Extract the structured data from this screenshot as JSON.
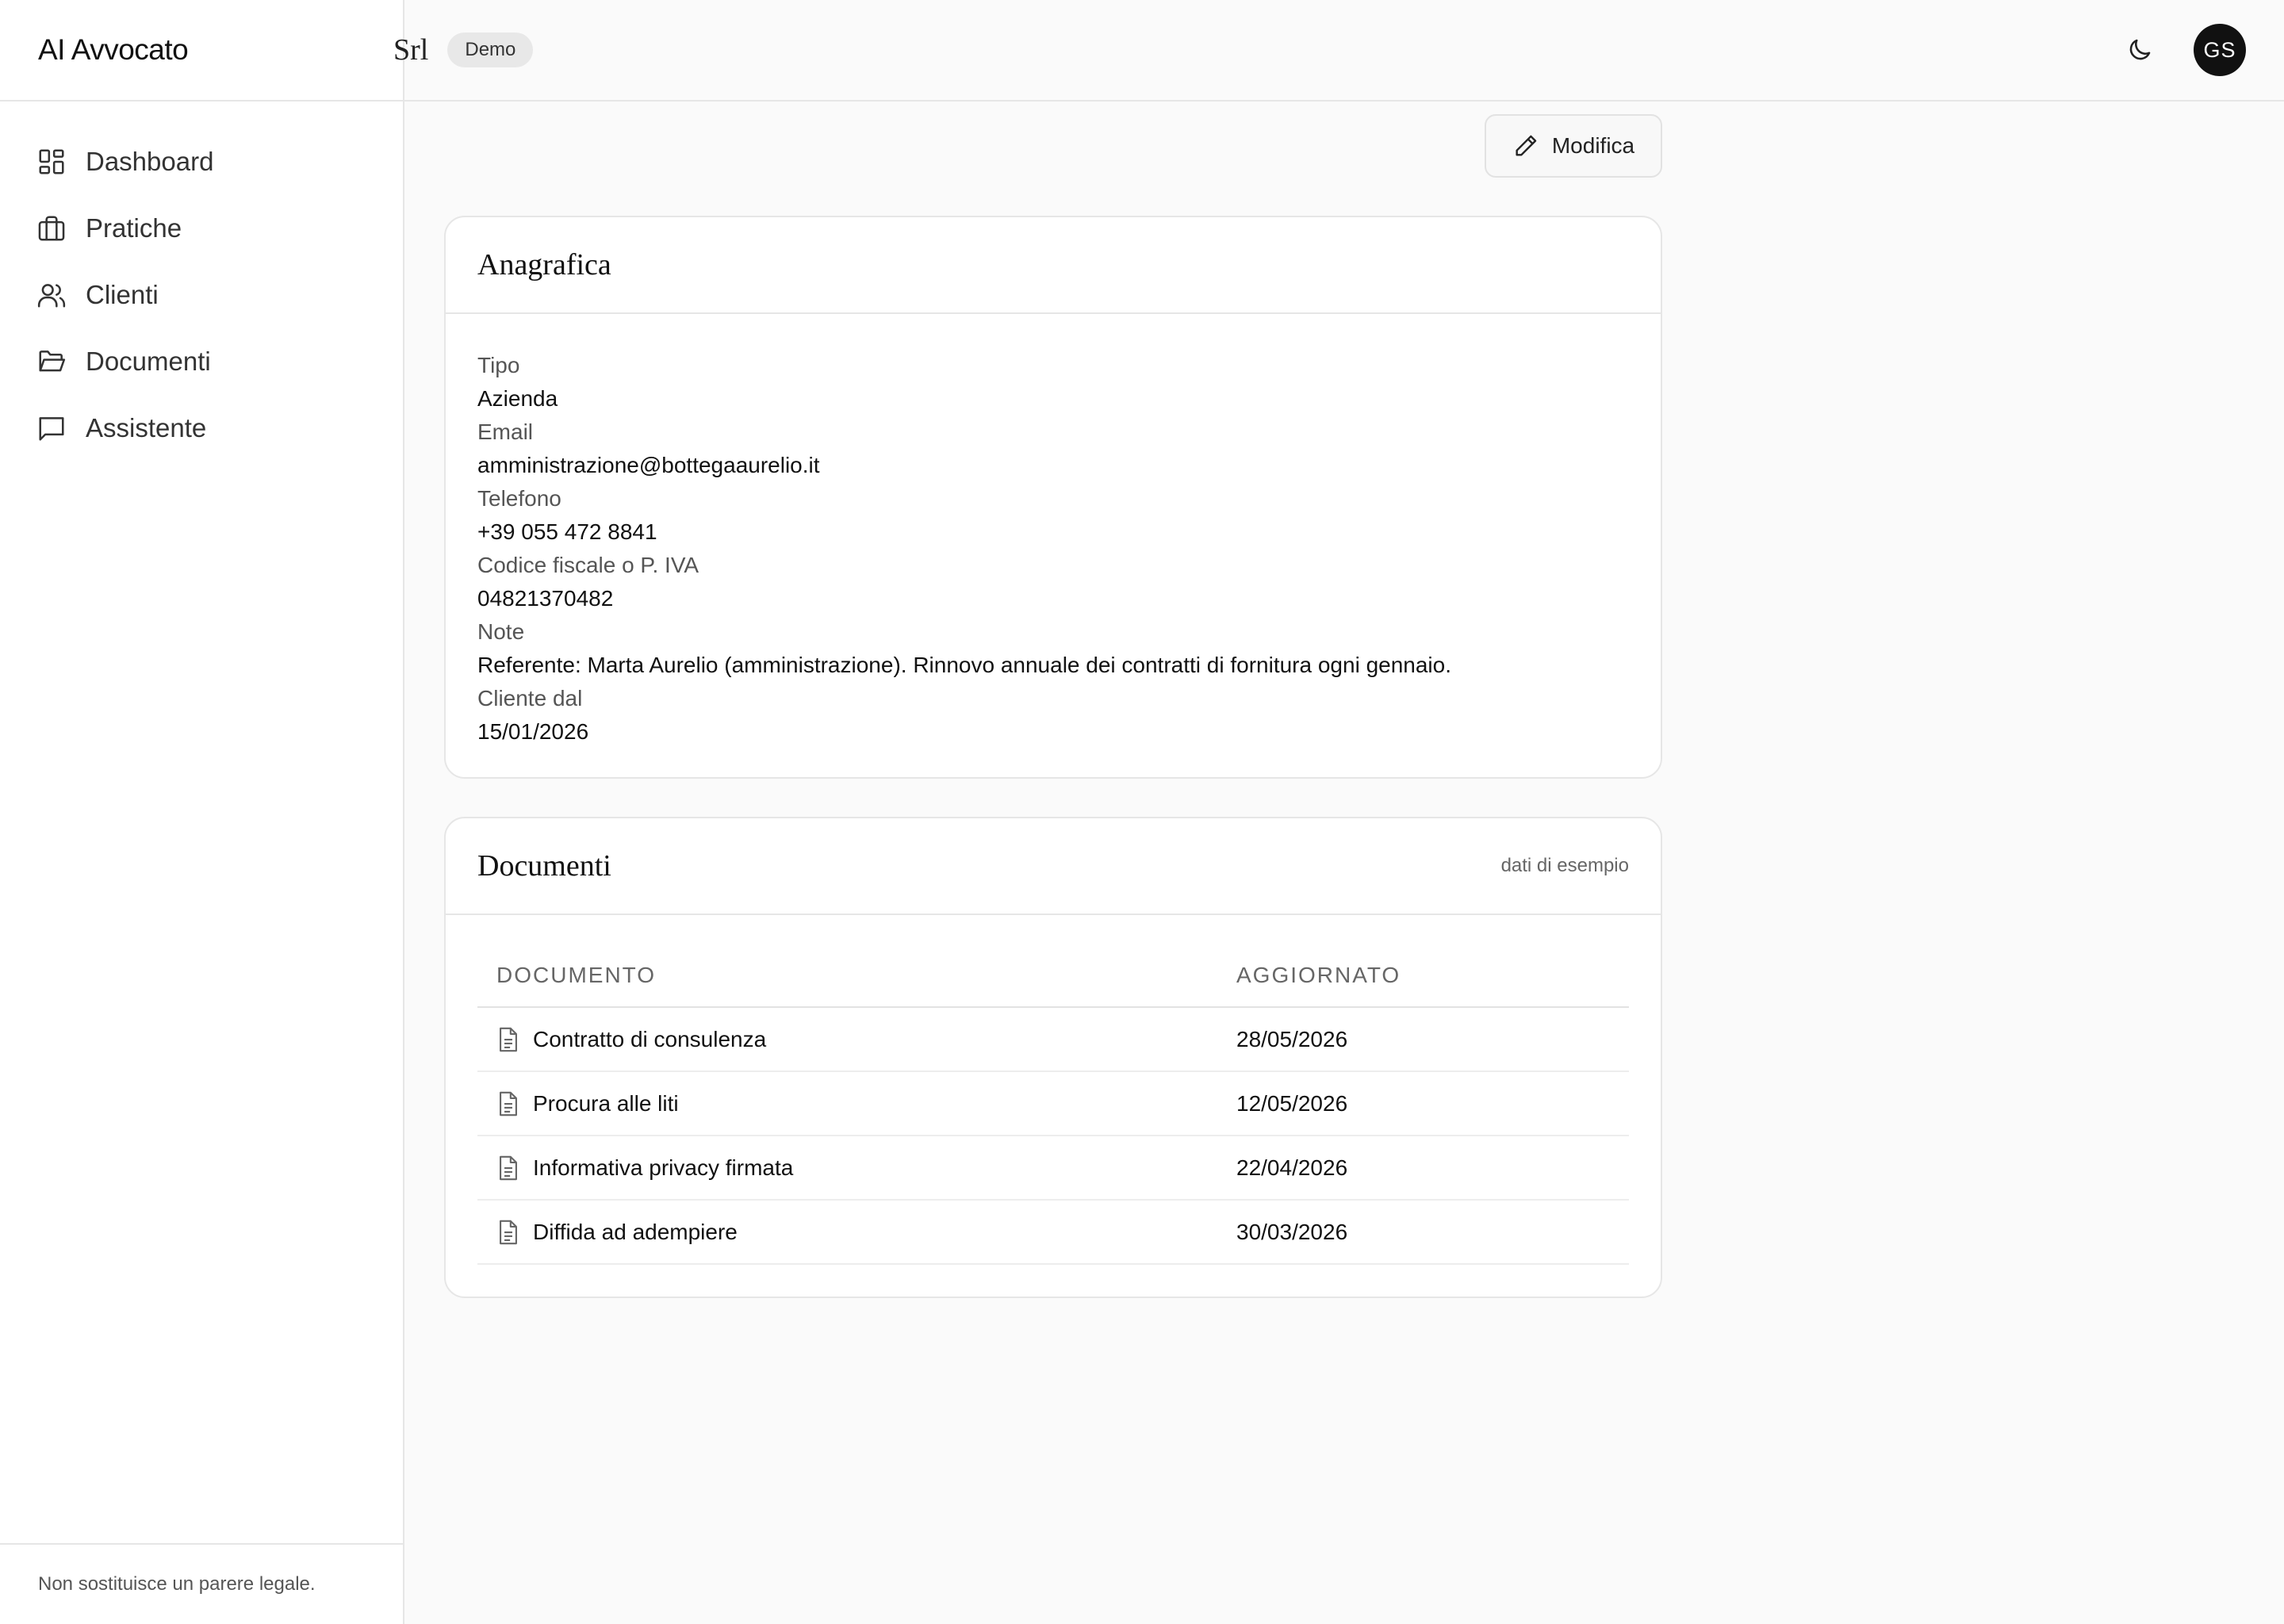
{
  "app": {
    "name": "AI Avvocato"
  },
  "header": {
    "title": "Srl",
    "badge": "Demo",
    "theme_icon": "moon-icon",
    "avatar_initials": "GS"
  },
  "sidebar": {
    "items": [
      {
        "label": "Dashboard",
        "icon": "dashboard-icon"
      },
      {
        "label": "Pratiche",
        "icon": "briefcase-icon"
      },
      {
        "label": "Clienti",
        "icon": "users-icon"
      },
      {
        "label": "Documenti",
        "icon": "folder-open-icon"
      },
      {
        "label": "Assistente",
        "icon": "chat-icon"
      }
    ],
    "footer": "Non sostituisce un parere legale."
  },
  "actions": {
    "edit_label": "Modifica"
  },
  "anagrafica": {
    "title": "Anagrafica",
    "fields": [
      {
        "label": "Tipo",
        "value": "Azienda"
      },
      {
        "label": "Email",
        "value": "amministrazione@bottegaaurelio.it"
      },
      {
        "label": "Telefono",
        "value": "+39 055 472 8841"
      },
      {
        "label": "Codice fiscale o P. IVA",
        "value": "04821370482"
      },
      {
        "label": "Note",
        "value": "Referente: Marta Aurelio (amministrazione). Rinnovo annuale dei contratti di fornitura ogni gennaio."
      },
      {
        "label": "Cliente dal",
        "value": "15/01/2026"
      }
    ]
  },
  "documenti": {
    "title": "Documenti",
    "subtitle": "dati di esempio",
    "columns": [
      "DOCUMENTO",
      "AGGIORNATO"
    ],
    "rows": [
      {
        "name": "Contratto di consulenza",
        "date": "28/05/2026"
      },
      {
        "name": "Procura alle liti",
        "date": "12/05/2026"
      },
      {
        "name": "Informativa privacy firmata",
        "date": "22/04/2026"
      },
      {
        "name": "Diffida ad adempiere",
        "date": "30/03/2026"
      }
    ]
  }
}
